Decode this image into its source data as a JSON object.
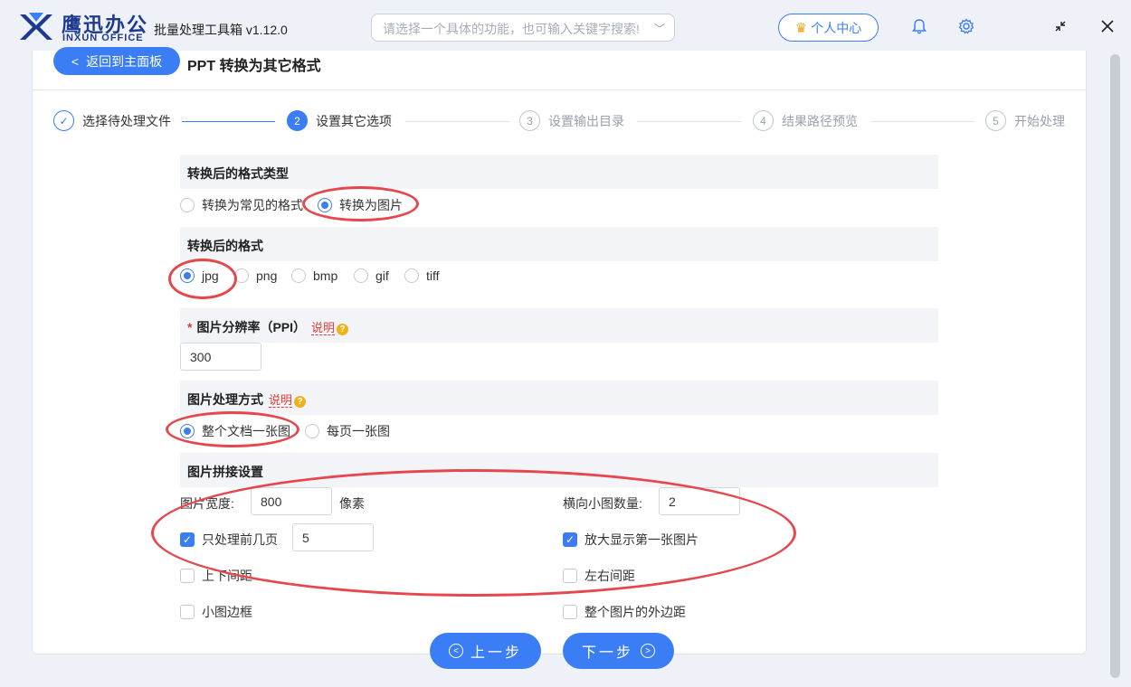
{
  "header": {
    "brand_cn": "鹰迅办公",
    "brand_en": "INXUN OFFICE",
    "app_title": "批量处理工具箱 v1.12.0",
    "search_placeholder": "请选择一个具体的功能，也可输入关键字搜索!",
    "user_center": "个人中心",
    "icons": [
      "bell-icon",
      "gear-icon",
      "collapse-icon",
      "close-icon"
    ]
  },
  "page": {
    "back_label": "返回到主面板",
    "title": "PPT 转换为其它格式"
  },
  "steps": [
    {
      "num": "✓",
      "label": "选择待处理文件",
      "state": "done"
    },
    {
      "num": "2",
      "label": "设置其它选项",
      "state": "active"
    },
    {
      "num": "3",
      "label": "设置输出目录",
      "state": "pending"
    },
    {
      "num": "4",
      "label": "结果路径预览",
      "state": "pending"
    },
    {
      "num": "5",
      "label": "开始处理",
      "state": "pending"
    }
  ],
  "format_type": {
    "title": "转换后的格式类型",
    "options": [
      "转换为常见的格式",
      "转换为图片"
    ],
    "selected": "转换为图片"
  },
  "format": {
    "title": "转换后的格式",
    "options": [
      "jpg",
      "png",
      "bmp",
      "gif",
      "tiff"
    ],
    "selected": "jpg"
  },
  "resolution": {
    "required_mark": "*",
    "title": "图片分辨率（PPI）",
    "help": "说明",
    "value": "300"
  },
  "processing": {
    "title": "图片处理方式",
    "help": "说明",
    "options": [
      "整个文档一张图",
      "每页一张图"
    ],
    "selected": "整个文档一张图"
  },
  "stitch": {
    "title": "图片拼接设置",
    "width_label": "图片宽度:",
    "width_value": "800",
    "width_unit": "像素",
    "h_count_label": "横向小图数量:",
    "h_count_value": "2",
    "first_pages_label": "只处理前几页",
    "first_pages_checked": true,
    "first_pages_value": "5",
    "enlarge_first_label": "放大显示第一张图片",
    "enlarge_first_checked": true,
    "vspacing_label": "上下间距",
    "vspacing_checked": false,
    "hspacing_label": "左右间距",
    "hspacing_checked": false,
    "border_label": "小图边框",
    "border_checked": false,
    "outer_margin_label": "整个图片的外边距",
    "outer_margin_checked": false
  },
  "nav": {
    "prev_label": "上一步",
    "next_label": "下一步"
  },
  "colors": {
    "accent": "#3a7df4",
    "annotation": "#e5474c",
    "brand": "#1d3a8f"
  }
}
